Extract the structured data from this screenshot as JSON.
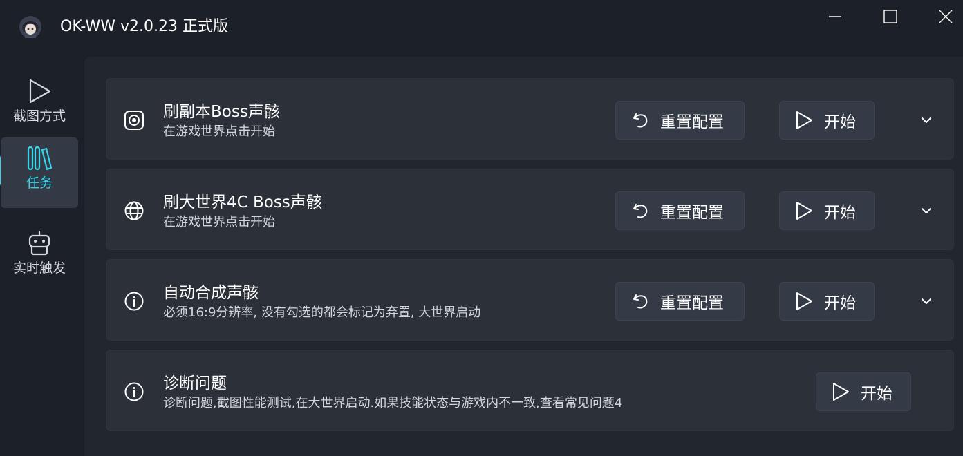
{
  "window": {
    "title": "OK-WW v2.0.23 正式版"
  },
  "sidebar": {
    "items": [
      {
        "label": "截图方式",
        "icon": "play-outline-icon"
      },
      {
        "label": "任务",
        "icon": "library-icon",
        "selected": true
      },
      {
        "label": "实时触发",
        "icon": "robot-icon"
      }
    ],
    "accent_color": "#36d6ec"
  },
  "tasks": [
    {
      "title": "刷副本Boss声骸",
      "description": "在游戏世界点击开始",
      "icon": "target-icon",
      "reset_label": "重置配置",
      "start_label": "开始"
    },
    {
      "title": "刷大世界4C Boss声骸",
      "description": "在游戏世界点击开始",
      "icon": "globe-icon",
      "reset_label": "重置配置",
      "start_label": "开始"
    },
    {
      "title": "自动合成声骸",
      "description": "必须16:9分辨率, 没有勾选的都会标记为弃置, 大世界启动",
      "icon": "info-icon",
      "reset_label": "重置配置",
      "start_label": "开始"
    },
    {
      "title": "诊断问题",
      "description": "诊断问题,截图性能测试,在大世界启动.如果技能状态与游戏内不一致,查看常见问题4",
      "icon": "info-icon",
      "start_label": "开始"
    }
  ]
}
